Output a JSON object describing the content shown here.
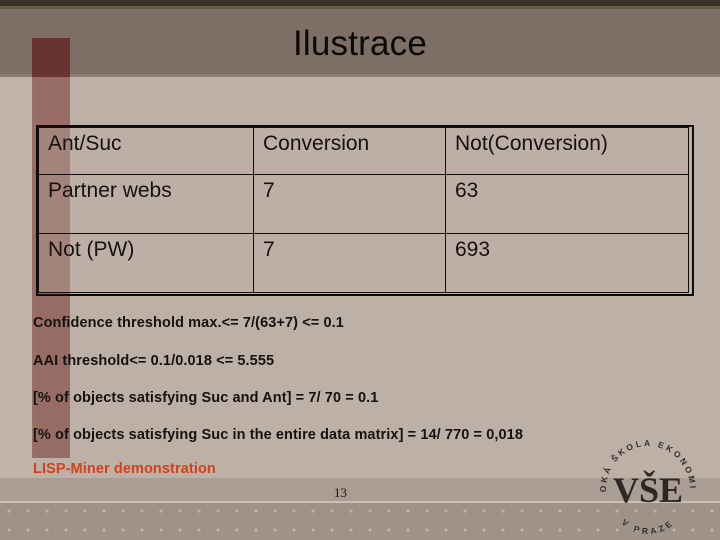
{
  "slide": {
    "title": "Ilustrace",
    "page_number": "13",
    "accent_color": "#d1421c",
    "header_color": "#7d6e66",
    "background_color": "#bdb0a6"
  },
  "table": {
    "columns": [
      "Ant/Suc",
      "Conversion",
      "Not(Conversion)"
    ],
    "rows": [
      {
        "label": "Partner webs",
        "conversion": "7",
        "not_conversion": "63"
      },
      {
        "label": "Not (PW)",
        "conversion": "7",
        "not_conversion": "693"
      }
    ]
  },
  "notes": [
    "Confidence threshold max.<= 7/(63+7) <= 0.1",
    "AAI threshold<= 0.1/0.018 <= 5.555",
    "[% of objects satisfying Suc and Ant] = 7/ 70 = 0.1",
    "[% of objects satisfying Suc in the entire data matrix] = 14/ 770 = 0,018"
  ],
  "link": {
    "label": "LISP-Miner demonstration"
  },
  "logo": {
    "name": "vse-prague-logo",
    "mark": "VŠE",
    "arc_top": "VYSOKÁ ŠKOLA EKONOMICKÁ",
    "arc_bottom": "V PRAZE"
  }
}
